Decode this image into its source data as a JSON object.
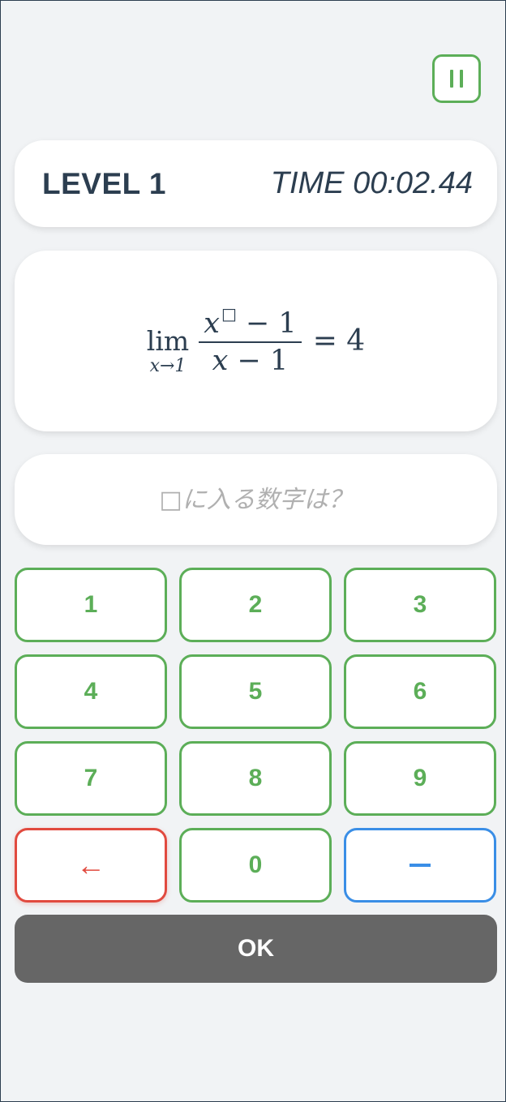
{
  "header": {
    "pause_icon": "pause-icon"
  },
  "status": {
    "level": "LEVEL 1",
    "time": "TIME 00:02.44"
  },
  "problem": {
    "lim": "lim",
    "lim_sub": "x→1",
    "numerator_var": "x",
    "numerator_box": "□",
    "numerator_rest": " − 1",
    "denominator_var": "x",
    "denominator_rest": " − 1",
    "rhs": "= 4"
  },
  "answer": {
    "placeholder": "□に入る数字は？",
    "value": ""
  },
  "keypad": {
    "k1": "1",
    "k2": "2",
    "k3": "3",
    "k4": "4",
    "k5": "5",
    "k6": "6",
    "k7": "7",
    "k8": "8",
    "k9": "9",
    "k0": "0",
    "backspace": "←",
    "minus_icon": "minus-icon"
  },
  "ok_label": "OK",
  "colors": {
    "accent_green": "#5cae58",
    "backspace_red": "#e14a3f",
    "minus_blue": "#3a8ee6",
    "ok_gray": "#666666",
    "text_dark": "#2c3e50"
  }
}
